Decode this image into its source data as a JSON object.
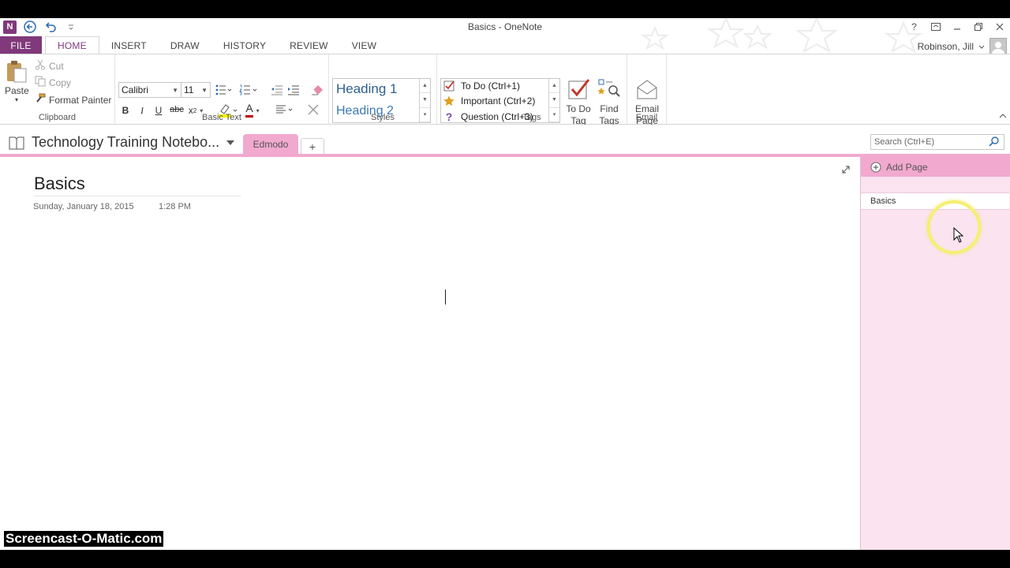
{
  "window": {
    "title": "Basics - OneNote"
  },
  "quick_access": {
    "logo_letter": "N"
  },
  "window_controls": {
    "help": "?"
  },
  "ribbon_tabs": [
    {
      "label": "FILE"
    },
    {
      "label": "HOME"
    },
    {
      "label": "INSERT"
    },
    {
      "label": "DRAW"
    },
    {
      "label": "HISTORY"
    },
    {
      "label": "REVIEW"
    },
    {
      "label": "VIEW"
    }
  ],
  "account": {
    "user": "Robinson, Jill"
  },
  "clipboard": {
    "paste": "Paste",
    "cut": "Cut",
    "copy": "Copy",
    "format_painter": "Format Painter",
    "group_label": "Clipboard"
  },
  "basic_text": {
    "font": "Calibri",
    "size": "11",
    "bold": "B",
    "italic": "I",
    "underline": "U",
    "strike": "abc",
    "subscript": "x",
    "subscript_mark": "2",
    "font_color_letter": "A",
    "group_label": "Basic Text"
  },
  "styles": {
    "items": [
      "Heading 1",
      "Heading 2"
    ],
    "group_label": "Styles"
  },
  "tags": {
    "items": [
      "To Do (Ctrl+1)",
      "Important (Ctrl+2)",
      "Question (Ctrl+3)"
    ],
    "question_glyph": "?",
    "todo_tag_line1": "To Do",
    "todo_tag_line2": "Tag",
    "find_tags_line1": "Find",
    "find_tags_line2": "Tags",
    "group_label": "Tags"
  },
  "email": {
    "line1": "Email",
    "line2": "Page",
    "group_label": "Email"
  },
  "notebook": {
    "name": "Technology Training Notebo...",
    "section": "Edmodo",
    "add_section": "+"
  },
  "search": {
    "placeholder": "Search (Ctrl+E)"
  },
  "page": {
    "title": "Basics",
    "date": "Sunday, January 18, 2015",
    "time": "1:28 PM"
  },
  "page_pane": {
    "add_page": "Add Page",
    "pages": [
      "Basics"
    ]
  },
  "watermark": "Screencast-O-Matic.com",
  "colors": {
    "accent": "#80397b",
    "section_pink": "#f2a9cf",
    "pane_pink": "#fbe3ef"
  }
}
